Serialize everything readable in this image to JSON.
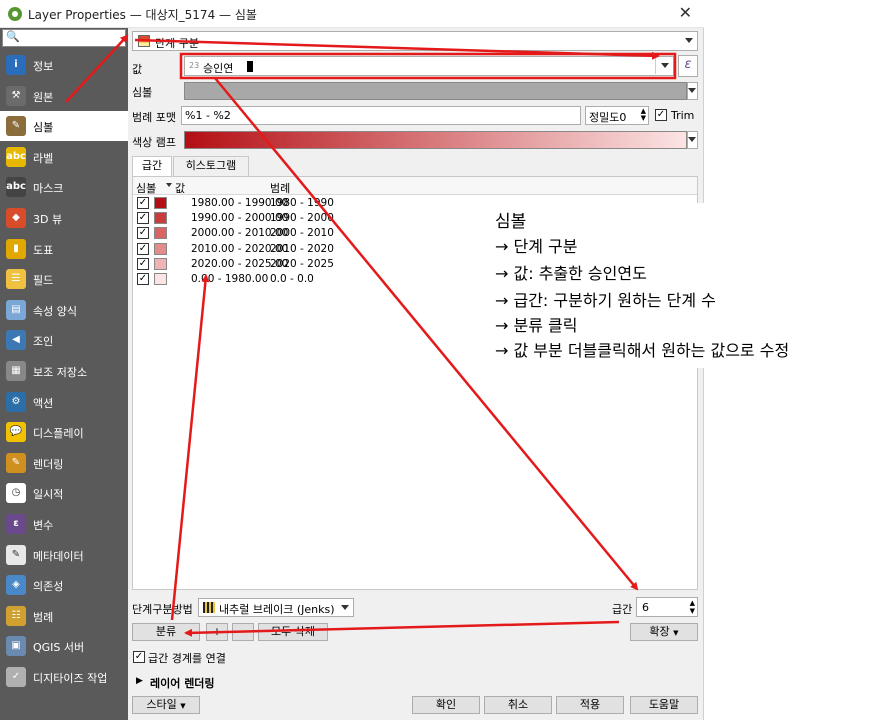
{
  "window": {
    "title": "Layer Properties — 대상지_5174 — 심볼",
    "close": "✕"
  },
  "sidebar": {
    "search_icon": "🔍",
    "items": [
      {
        "label": "정보",
        "icon": "info-icon",
        "color": "#2a6ebb",
        "glyph": "i"
      },
      {
        "label": "원본",
        "icon": "source-icon",
        "color": "#6b6b6b",
        "glyph": "⚒"
      },
      {
        "label": "심볼",
        "icon": "paintbrush-icon",
        "color": "#8a6d3b",
        "glyph": "✎"
      },
      {
        "label": "라벨",
        "icon": "label-icon",
        "color": "#e6b800",
        "glyph": "abc"
      },
      {
        "label": "마스크",
        "icon": "mask-icon",
        "color": "#444444",
        "glyph": "abc"
      },
      {
        "label": "3D 뷰",
        "icon": "cube-icon",
        "color": "#d84c2b",
        "glyph": "◆"
      },
      {
        "label": "도표",
        "icon": "diagram-icon",
        "color": "#e0a800",
        "glyph": "▮"
      },
      {
        "label": "필드",
        "icon": "fields-icon",
        "color": "#f0c040",
        "glyph": "☰"
      },
      {
        "label": "속성 양식",
        "icon": "form-icon",
        "color": "#7aa7d6",
        "glyph": "▤"
      },
      {
        "label": "조인",
        "icon": "join-icon",
        "color": "#3c78b4",
        "glyph": "◀"
      },
      {
        "label": "보조 저장소",
        "icon": "storage-icon",
        "color": "#888888",
        "glyph": "▦"
      },
      {
        "label": "액션",
        "icon": "action-icon",
        "color": "#2c6ea8",
        "glyph": "⚙"
      },
      {
        "label": "디스플레이",
        "icon": "display-icon",
        "color": "#f2c200",
        "glyph": "💬"
      },
      {
        "label": "렌더링",
        "icon": "rendering-icon",
        "color": "#d09020",
        "glyph": "✎"
      },
      {
        "label": "일시적",
        "icon": "clock-icon",
        "color": "#ffffff",
        "glyph": "◷"
      },
      {
        "label": "변수",
        "icon": "variable-icon",
        "color": "#6a4a8a",
        "glyph": "ε"
      },
      {
        "label": "메타데이터",
        "icon": "metadata-icon",
        "color": "#e8e8e8",
        "glyph": "✎"
      },
      {
        "label": "의존성",
        "icon": "dependency-icon",
        "color": "#4a88c8",
        "glyph": "◈"
      },
      {
        "label": "범례",
        "icon": "legend-icon",
        "color": "#d0a030",
        "glyph": "☷"
      },
      {
        "label": "QGIS 서버",
        "icon": "server-icon",
        "color": "#6a8ab0",
        "glyph": "▣"
      },
      {
        "label": "디지타이즈 작업",
        "icon": "digitize-icon",
        "color": "#b0b0b0",
        "glyph": "✓"
      }
    ],
    "active_index": 2
  },
  "renderer": {
    "label": "단계 구분"
  },
  "value": {
    "label": "값",
    "type_prefix": "23",
    "field": "승인연",
    "epsilon": "ε"
  },
  "symbol": {
    "label": "심볼"
  },
  "legend_format": {
    "label": "범례 포맷",
    "value": "%1 - %2",
    "precision_label": "정밀도0",
    "trim_label": "Trim"
  },
  "color_ramp": {
    "label": "색상 램프"
  },
  "tabs": [
    "급간",
    "히스토그램"
  ],
  "table": {
    "headers": {
      "symbol": "심볼",
      "value": "값",
      "legend": "범례"
    },
    "rows": [
      {
        "value": "1980.00 - 1990.00",
        "legend": "1980 - 1990",
        "color": "#b40f14"
      },
      {
        "value": "1990.00 - 2000.00",
        "legend": "1990 - 2000",
        "color": "#c83c3c"
      },
      {
        "value": "2000.00 - 2010.00",
        "legend": "2000 - 2010",
        "color": "#d86464"
      },
      {
        "value": "2010.00 - 2020.00",
        "legend": "2010 - 2020",
        "color": "#e48c8c"
      },
      {
        "value": "2020.00 - 2025.00",
        "legend": "2020 - 2025",
        "color": "#f0b4b4"
      },
      {
        "value": "0.00 - 1980.00",
        "legend": "0.0 - 0.0",
        "color": "#fce4e4"
      }
    ]
  },
  "mode": {
    "label": "단계구분방법",
    "value": "내추럴 브레이크 (Jenks)",
    "classes_label": "급간",
    "classes_value": "6"
  },
  "buttons": {
    "classify": "분류",
    "delete_all": "모두 삭제",
    "expand": "확장",
    "ok": "확인",
    "cancel": "취소",
    "apply": "적용",
    "help": "도움말",
    "style": "스타일"
  },
  "link_boundaries": "급간 경계를 연결",
  "layer_rendering": "레이어 렌더링",
  "annotation": {
    "title": "심볼",
    "lines": [
      "→  단계 구분",
      "→  값: 추출한 승인연도",
      "→  급간: 구분하기 원하는 단계 수",
      "→  분류 클릭",
      "→  값 부분 더블클릭해서 원하는 값으로 수정"
    ]
  },
  "colors": {
    "accent": "#e41a1a",
    "sidebar_bg": "#5a5a5a",
    "ramp_start": "#b40f14",
    "ramp_end": "#fce4e4"
  }
}
